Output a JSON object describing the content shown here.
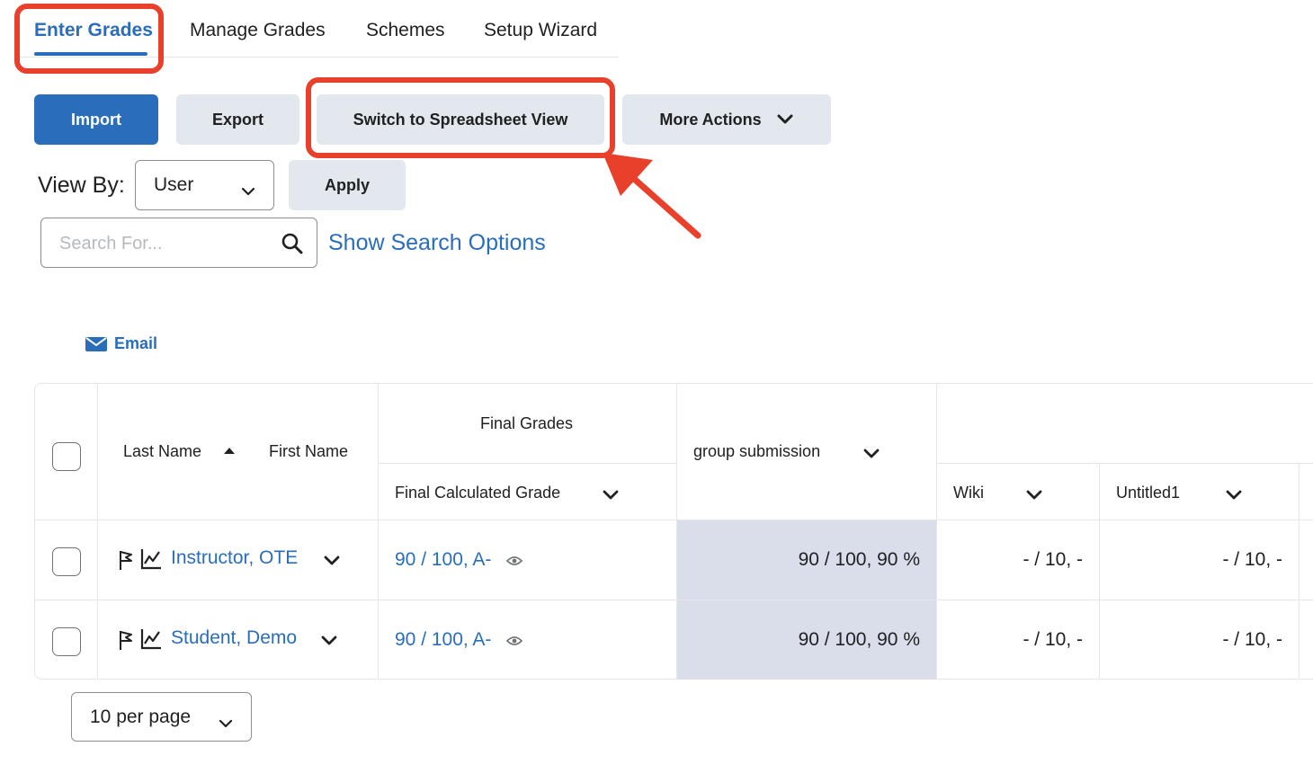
{
  "tabs": [
    {
      "label": "Enter Grades",
      "active": true
    },
    {
      "label": "Manage Grades",
      "active": false
    },
    {
      "label": "Schemes",
      "active": false
    },
    {
      "label": "Setup Wizard",
      "active": false
    }
  ],
  "toolbar": {
    "import_label": "Import",
    "export_label": "Export",
    "spreadsheet_label": "Switch to Spreadsheet View",
    "more_actions_label": "More Actions"
  },
  "view_by": {
    "label": "View By:",
    "selected": "User",
    "apply_label": "Apply"
  },
  "search": {
    "placeholder": "Search For...",
    "options_link": "Show Search Options"
  },
  "email_label": "Email",
  "table": {
    "headers": {
      "last_name": "Last Name",
      "first_name": "First Name",
      "final_grades": "Final Grades",
      "final_calculated": "Final Calculated Grade",
      "group_submission": "group submission",
      "wiki": "Wiki",
      "untitled1": "Untitled1"
    },
    "rows": [
      {
        "name": "Instructor, OTE",
        "final": "90 / 100, A-",
        "group": "90 / 100, 90 %",
        "wiki": "- / 10, -",
        "untitled1": "- / 10, -"
      },
      {
        "name": "Student, Demo",
        "final": "90 / 100, A-",
        "group": "90 / 100, 90 %",
        "wiki": "- / 10, -",
        "untitled1": "- / 10, -"
      }
    ]
  },
  "pagination": {
    "per_page": "10 per page"
  },
  "colors": {
    "accent": "#2a6ebb",
    "callout": "#e8402a",
    "button_gray": "#e3e7ee",
    "shaded_cell": "#d9deea"
  },
  "icons": [
    "search-icon",
    "chevron-down-icon",
    "email-icon",
    "sort-ascending-icon",
    "flag-icon",
    "stats-icon",
    "eye-icon",
    "arrow-icon"
  ]
}
